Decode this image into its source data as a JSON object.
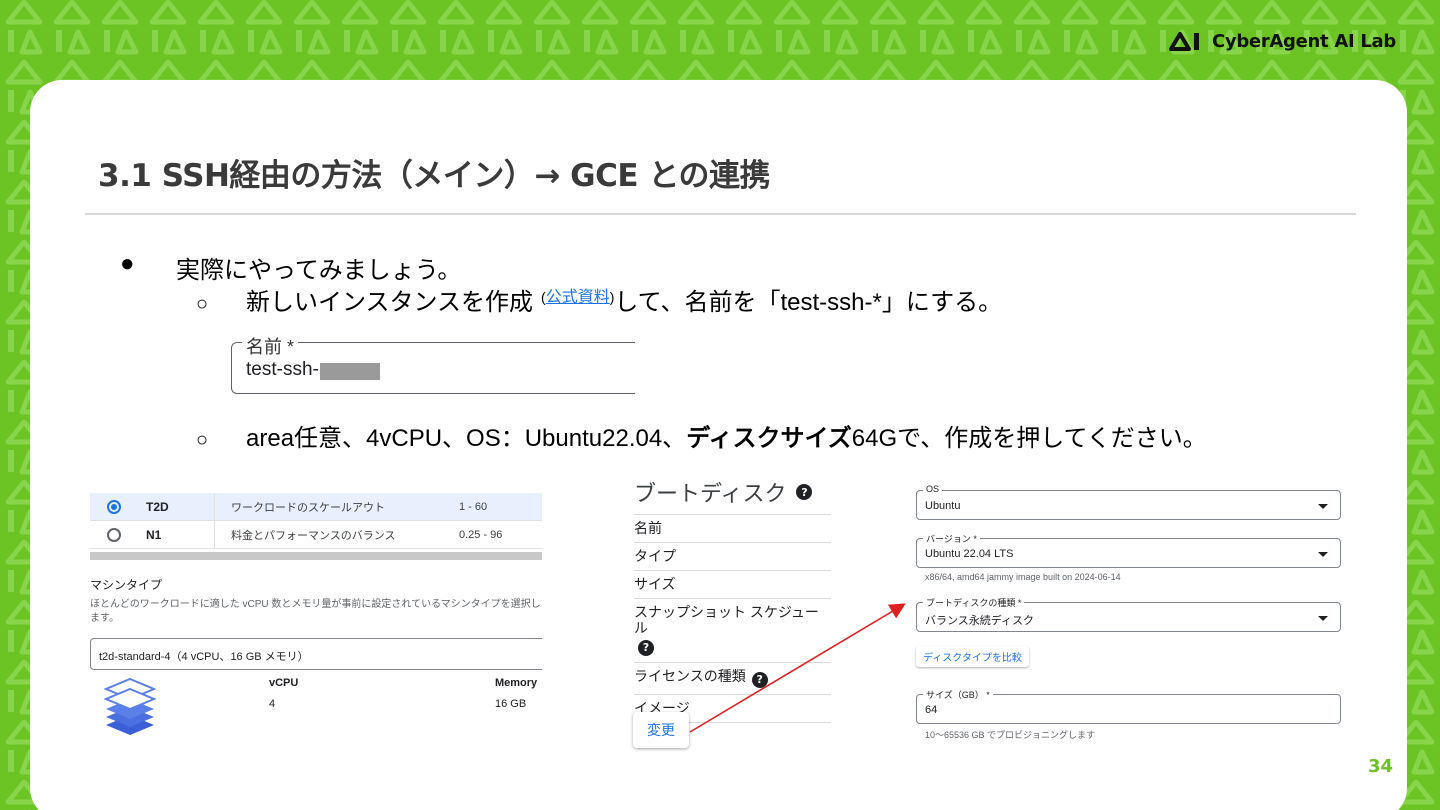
{
  "brand": {
    "name": "CyberAgent AI Lab",
    "logo_icon": "ai-logo-icon"
  },
  "slide": {
    "title": "3.1 SSH経由の方法（メイン）→ GCE との連携",
    "page_number": "34"
  },
  "bullets": {
    "b1_marker": "●",
    "b1_text": "実際にやってみましょう。",
    "b2_marker": "○",
    "b2_text_before": "新しいインスタンスを作成",
    "b2_paren_open": "(",
    "b2_link": "公式資料",
    "b2_paren_close": ")",
    "b2_text_after": "して、名前を「test-ssh-*」にする。",
    "b3_marker": "○",
    "b3_text": "area任意、4vCPU、OS：Ubuntu22.04、",
    "b3_bold": "ディスクサイズ",
    "b3_tail": "64Gで、作成を押してください。"
  },
  "name_field": {
    "label": "名前 *",
    "value": "test-ssh-"
  },
  "machine_series": [
    {
      "series": "T2D",
      "description": "ワークロードのスケールアウト",
      "range": "1 - 60",
      "selected": true
    },
    {
      "series": "N1",
      "description": "料金とパフォーマンスのバランス",
      "range": "0.25 - 96",
      "selected": false
    }
  ],
  "machine_type": {
    "title": "マシンタイプ",
    "description": "ほとんどのワークロードに適した vCPU 数とメモリ量が事前に設定されているマシンタイプを選択します。",
    "selected": "t2d-standard-4（4 vCPU、16 GB メモリ）",
    "vcpu_header": "vCPU",
    "vcpu_value": "4",
    "memory_header": "Memory",
    "memory_value": "16 GB"
  },
  "boot_disk": {
    "title": "ブートディスク",
    "rows": [
      "名前",
      "タイプ",
      "サイズ",
      "スナップショット スケジュール",
      "ライセンスの種類",
      "イメージ"
    ],
    "change_button": "変更"
  },
  "os_form": {
    "os_label": "OS",
    "os_value": "Ubuntu",
    "version_label": "バージョン *",
    "version_value": "Ubuntu 22.04 LTS",
    "version_hint": "x86/64, amd64 jammy image built on 2024-06-14",
    "disk_type_label": "ブートディスクの種類 *",
    "disk_type_value": "バランス永続ディスク",
    "compare_button": "ディスクタイプを比較",
    "size_label": "サイズ（GB） *",
    "size_value": "64",
    "size_hint": "10〜65536 GB でプロビジョニングします"
  },
  "colors": {
    "brand_green": "#6cc424",
    "link_blue": "#1a73e8",
    "arrow_red": "#e02020"
  }
}
